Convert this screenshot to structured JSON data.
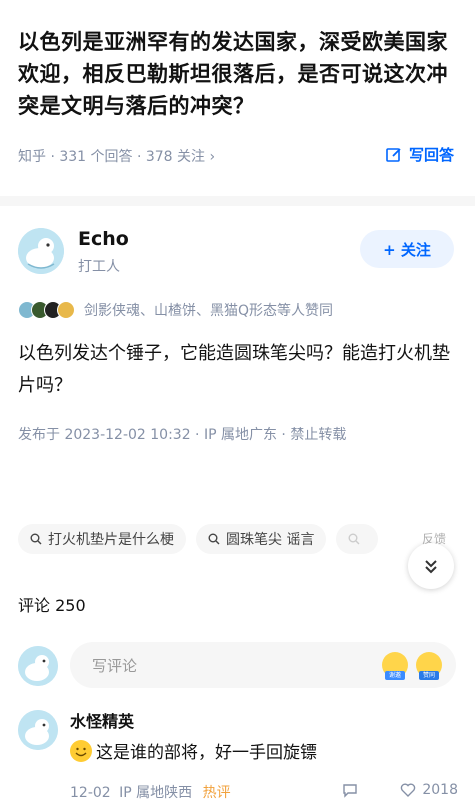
{
  "question": {
    "title": "以色列是亚洲罕有的发达国家，深受欧美国家欢迎，相反巴勒斯坦很落后，是否可说这次冲突是文明与落后的冲突？",
    "meta": "知乎 · 331 个回答 · 378 关注 ›",
    "write_answer_label": "写回答"
  },
  "answer": {
    "author": {
      "name": "Echo",
      "bio": "打工人"
    },
    "follow_label": "+ 关注",
    "upvoters_text": "剑影侠魂、山楂饼、黑猫Q形态等人赞同",
    "body": "以色列发达个锤子，它能造圆珠笔尖吗？能造打火机垫片吗？",
    "post_meta": "发布于 2023-12-02 10:32 · IP 属地广东 · 禁止转载"
  },
  "tags": [
    {
      "label": "打火机垫片是什么梗"
    },
    {
      "label": "圆珠笔尖 谣言"
    },
    {
      "label": ""
    }
  ],
  "feedback_label": "反馈",
  "comments": {
    "header": "评论 250",
    "input_placeholder": "写评论",
    "emoji_badges": [
      "谢邀",
      "赞同"
    ],
    "items": [
      {
        "author": "水怪精英",
        "text": "这是谁的部将，好一手回旋镖",
        "date": "12-02",
        "ip": "IP 属地陕西",
        "hot_label": "热评",
        "likes": "2018"
      }
    ]
  },
  "colors": {
    "accent": "#0066ff",
    "muted": "#8590a6",
    "hot": "#f1a13c"
  }
}
